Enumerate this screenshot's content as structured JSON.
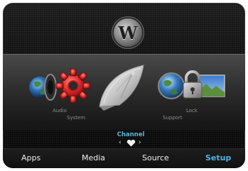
{
  "brand": {
    "logo_letter": "W"
  },
  "carousel": {
    "labels": {
      "audio": "Audio",
      "system": "System",
      "support": "Support",
      "lock": "Lock"
    },
    "focused_item": "Channel"
  },
  "tabs": [
    {
      "label": "Apps",
      "active": false
    },
    {
      "label": "Media",
      "active": false
    },
    {
      "label": "Source",
      "active": false
    },
    {
      "label": "Setup",
      "active": true
    }
  ],
  "colors": {
    "accent": "#4fb3e8",
    "channel": "#5fb6da"
  },
  "icons": {
    "audio": "speaker-icon",
    "system": "gear-icon",
    "channel": "satellite-dish-icon",
    "support": "globe-icon",
    "lock": "padlock-icon"
  }
}
